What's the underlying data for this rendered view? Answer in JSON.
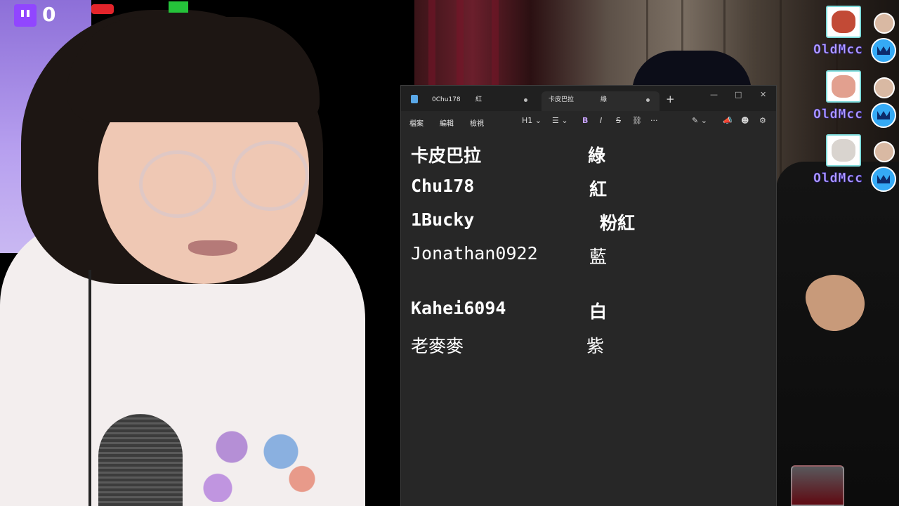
{
  "overlay": {
    "twitch_count": "0"
  },
  "chat": [
    {
      "username": "OldMcc",
      "emote": "emote-face-red",
      "emote_color": "#c24a36"
    },
    {
      "username": "OldMcc",
      "emote": "emote-face-pink",
      "emote_color": "#e2a08f"
    },
    {
      "username": "OldMcc",
      "emote": "emote-cat",
      "emote_color": "#d9d4cf"
    }
  ],
  "notepad": {
    "tabs": [
      {
        "name": "0Chu178",
        "color": "紅",
        "active": false
      },
      {
        "name": "卡皮巴拉",
        "color": "綠",
        "active": true
      }
    ],
    "new_tab": "+",
    "window_controls": {
      "minimize": "—",
      "maximize": "□",
      "close": "✕"
    },
    "menu": {
      "file": "檔案",
      "edit": "編輯",
      "view": "檢視"
    },
    "toolbar": {
      "heading": "H1 ⌄",
      "list": "☰ ⌄",
      "bold": "B",
      "italic": "I",
      "strike": "S",
      "link": "⛓",
      "more": "···",
      "copilot": "✎ ⌄",
      "announce": "📣",
      "avatar": "☻",
      "settings": "⚙"
    },
    "lines": [
      {
        "name": "卡皮巴拉",
        "color": "綠",
        "bold": true
      },
      {
        "name": "Chu178",
        "color": "紅",
        "bold": true
      },
      {
        "name": "1Bucky",
        "color": "粉紅",
        "bold": true
      },
      {
        "name": "Jonathan0922",
        "color": "藍",
        "bold": false
      },
      {
        "name": "Kahei6094",
        "color": "白",
        "bold": true
      },
      {
        "name": "老麥麥",
        "color": "紫",
        "bold": false
      }
    ]
  }
}
